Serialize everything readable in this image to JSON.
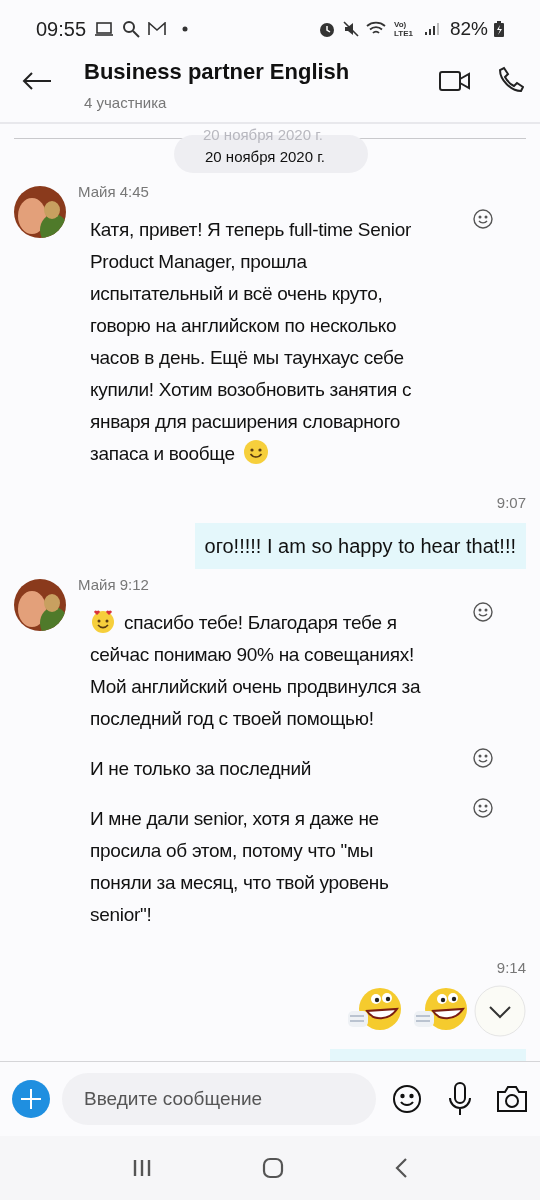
{
  "status_bar": {
    "time": "09:55",
    "battery": "82%",
    "network_label": "Vo) LTE1"
  },
  "header": {
    "title": "Business partner English",
    "subtitle": "4 участника"
  },
  "date_separator": {
    "label": "20 ноября 2020 г.",
    "ghost_label": "20 ноября 2020 г."
  },
  "groups": [
    {
      "kind": "incoming",
      "author": "Майя",
      "time": "4:45",
      "messages": [
        {
          "text": "Катя, привет! Я теперь full-time Senior Product Manager, прошла испытательный и всё очень круто, говорю на английском по несколько часов в день. Ещё мы таунхаус себе купили! Хотим возобновить занятия с января для расширения словарного запаса и вообще",
          "trailing_emoji": true
        }
      ]
    },
    {
      "kind": "outgoing",
      "time": "9:07",
      "messages": [
        {
          "text": "ого!!!!! I am so happy to hear that!!!"
        }
      ]
    },
    {
      "kind": "incoming",
      "author": "Майя",
      "time": "9:12",
      "messages": [
        {
          "text": "спасибо тебе! Благодаря тебе я сейчас понимаю 90% на совещаниях! Мой английский очень продвинулся за последний год с твоей помощью!",
          "leading_emoji": true
        },
        {
          "text": "И не только за последний"
        },
        {
          "text": "И мне дали senior, хотя я даже не просила об этом, потому что \"мы поняли за месяц, что твой уровень senior\"!"
        }
      ]
    },
    {
      "kind": "stickers",
      "time": "9:14",
      "stickers": [
        {
          "kind": "laugh"
        },
        {
          "kind": "laugh"
        }
      ]
    }
  ],
  "composer": {
    "placeholder": "Введите сообщение"
  }
}
